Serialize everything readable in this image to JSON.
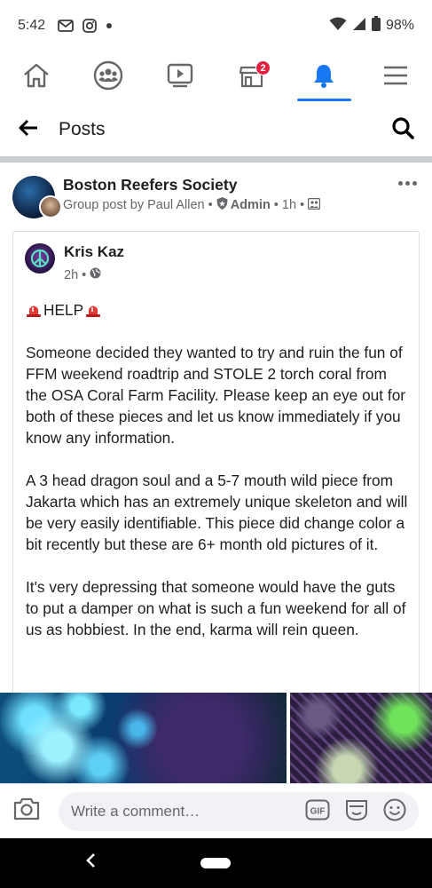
{
  "status_bar": {
    "time": "5:42",
    "icons": [
      "gmail-icon",
      "instagram-icon",
      "dot-icon"
    ],
    "battery": "98%"
  },
  "nav": {
    "items": [
      {
        "name": "home-icon",
        "active": false
      },
      {
        "name": "groups-icon",
        "active": false
      },
      {
        "name": "watch-icon",
        "active": false
      },
      {
        "name": "marketplace-icon",
        "active": false,
        "badge": "2"
      },
      {
        "name": "notifications-icon",
        "active": true
      },
      {
        "name": "menu-icon",
        "active": false
      }
    ],
    "accent_color": "#1877f2",
    "badge_color": "#e41e3f"
  },
  "header": {
    "title": "Posts"
  },
  "post": {
    "group_name": "Boston Reefers Society",
    "meta_prefix": "Group post by Paul Allen",
    "role": "Admin",
    "time": "1h",
    "shared": {
      "author": "Kris Kaz",
      "time": "2h",
      "help": "HELP",
      "paragraphs": [
        "Someone decided they wanted to try and ruin the fun of FFM weekend roadtrip and STOLE 2 torch coral from the OSA Coral Farm Facility. Please keep an eye out for both of these pieces and let us know immediately if you know any information.",
        "A 3 head dragon soul and a 5-7 mouth wild piece from Jakarta which has an extremely unique skeleton and will be very easily identifiable. This piece did change color a bit recently but these are 6+ month old pictures of it.",
        "It's very depressing that someone would have the guts to put a damper on what is such a fun weekend for all of us as hobbiest. In the end, karma will rein queen."
      ]
    }
  },
  "comment": {
    "placeholder": "Write a comment…"
  }
}
